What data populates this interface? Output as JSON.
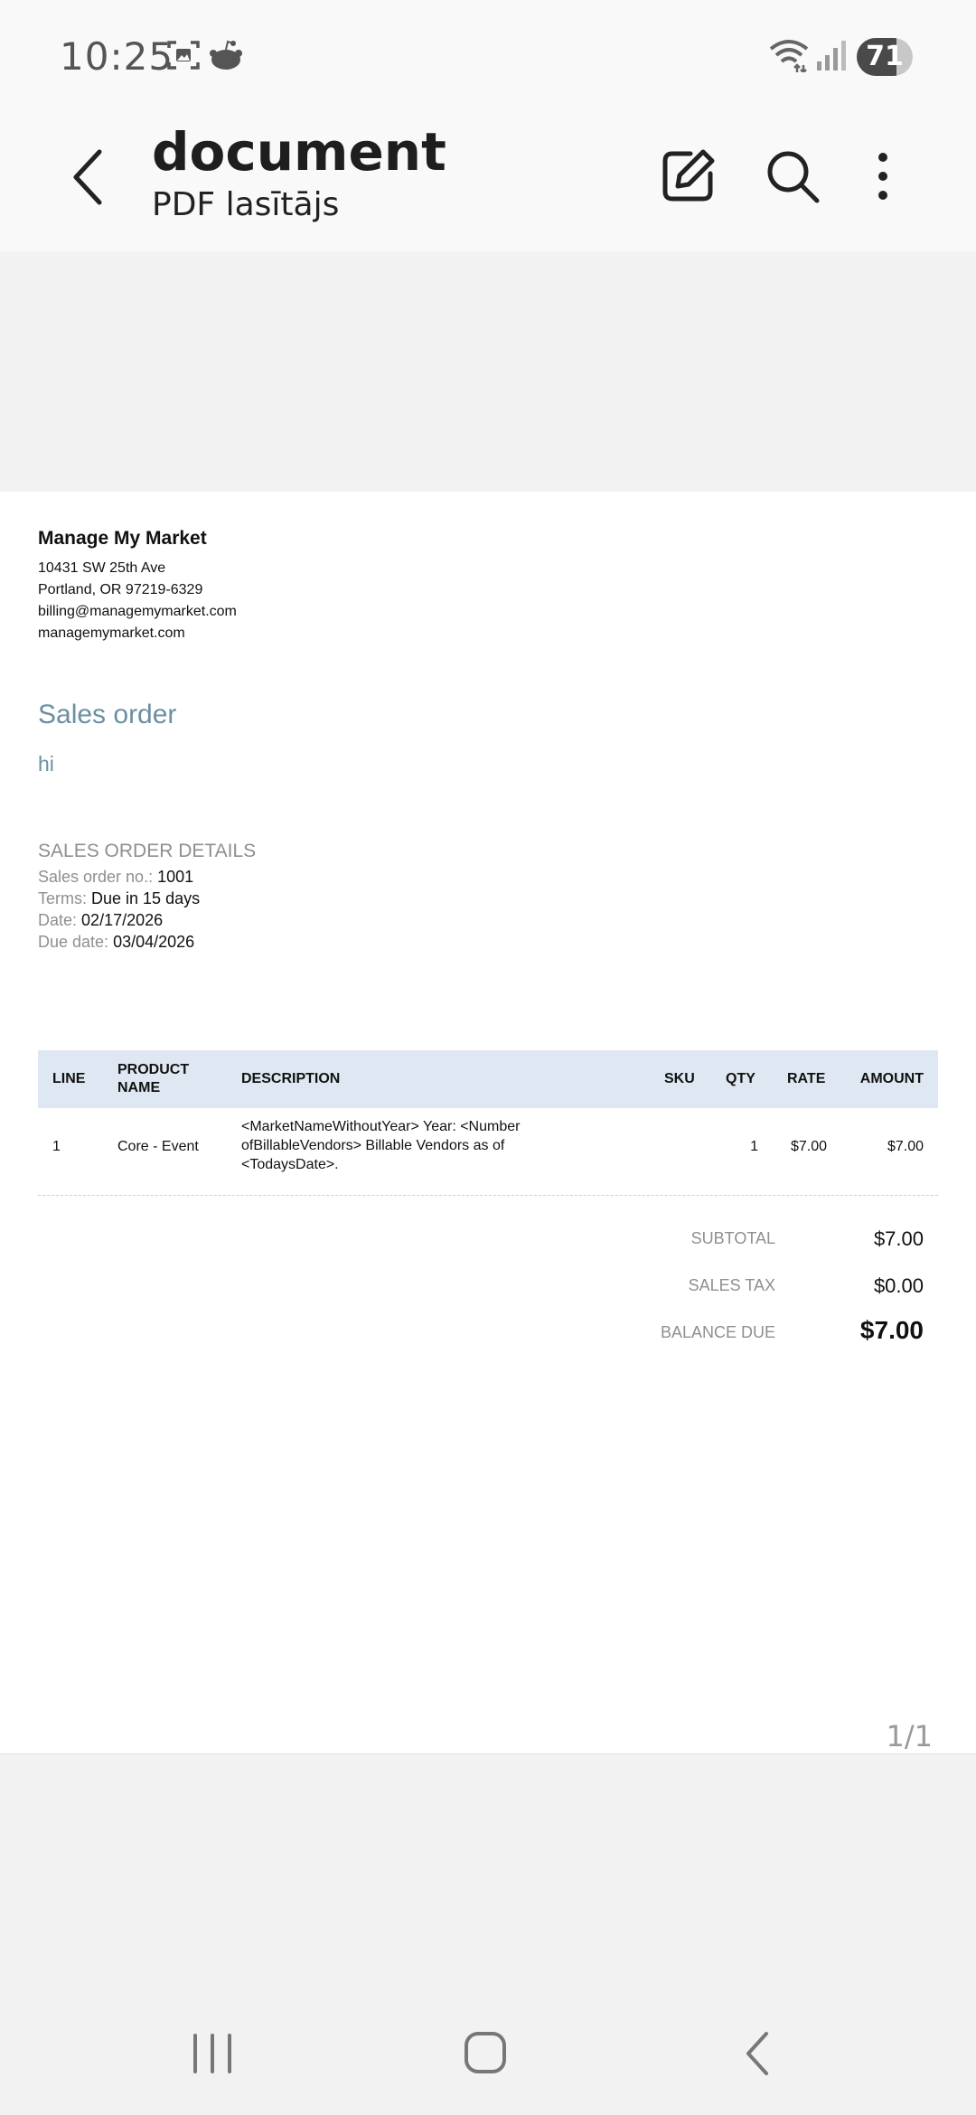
{
  "status_bar": {
    "time": "10:25",
    "battery": "71",
    "battery_level": 0.71,
    "icons": [
      "screenshot-icon",
      "reddit-icon",
      "wifi-icon",
      "signal-icon",
      "battery-icon"
    ]
  },
  "app_bar": {
    "title": "document",
    "subtitle": "PDF lasītājs",
    "icons": [
      "back-arrow-icon",
      "edit-icon",
      "search-icon",
      "more-vert-icon"
    ]
  },
  "document": {
    "company": {
      "name": "Manage My Market",
      "address_line1": "10431 SW 25th Ave",
      "address_line2": "Portland, OR 97219-6329",
      "email": "billing@managemymarket.com",
      "website": "managemymarket.com"
    },
    "doc_type": "Sales order",
    "memo": "hi",
    "details": {
      "heading": "SALES ORDER DETAILS",
      "order_no_label": "Sales order no.:",
      "order_no": "1001",
      "terms_label": "Terms:",
      "terms": "Due in 15 days",
      "date_label": "Date:",
      "date": "02/17/2026",
      "due_label": "Due date:",
      "due": "03/04/2026"
    },
    "table": {
      "headers": {
        "line": "LINE",
        "product_line1": "PRODUCT",
        "product_line2": "NAME",
        "description": "DESCRIPTION",
        "sku": "SKU",
        "qty": "QTY",
        "rate": "RATE",
        "amount": "AMOUNT"
      },
      "rows": [
        {
          "line": "1",
          "product": "Core - Event",
          "desc_line1": "<MarketNameWithoutYear> Year: <Number",
          "desc_line2": "ofBillableVendors> Billable Vendors as of",
          "desc_line3": "<TodaysDate>.",
          "sku": "",
          "qty": "1",
          "rate": "$7.00",
          "amount": "$7.00"
        }
      ]
    },
    "totals": {
      "subtotal_label": "SUBTOTAL",
      "subtotal": "$7.00",
      "tax_label": "SALES TAX",
      "tax": "$0.00",
      "balance_label": "BALANCE DUE",
      "balance": "$7.00"
    }
  },
  "page_counter": "1/1",
  "nav_bar": {
    "icons": [
      "recent-apps-icon",
      "home-icon",
      "back-icon"
    ]
  }
}
